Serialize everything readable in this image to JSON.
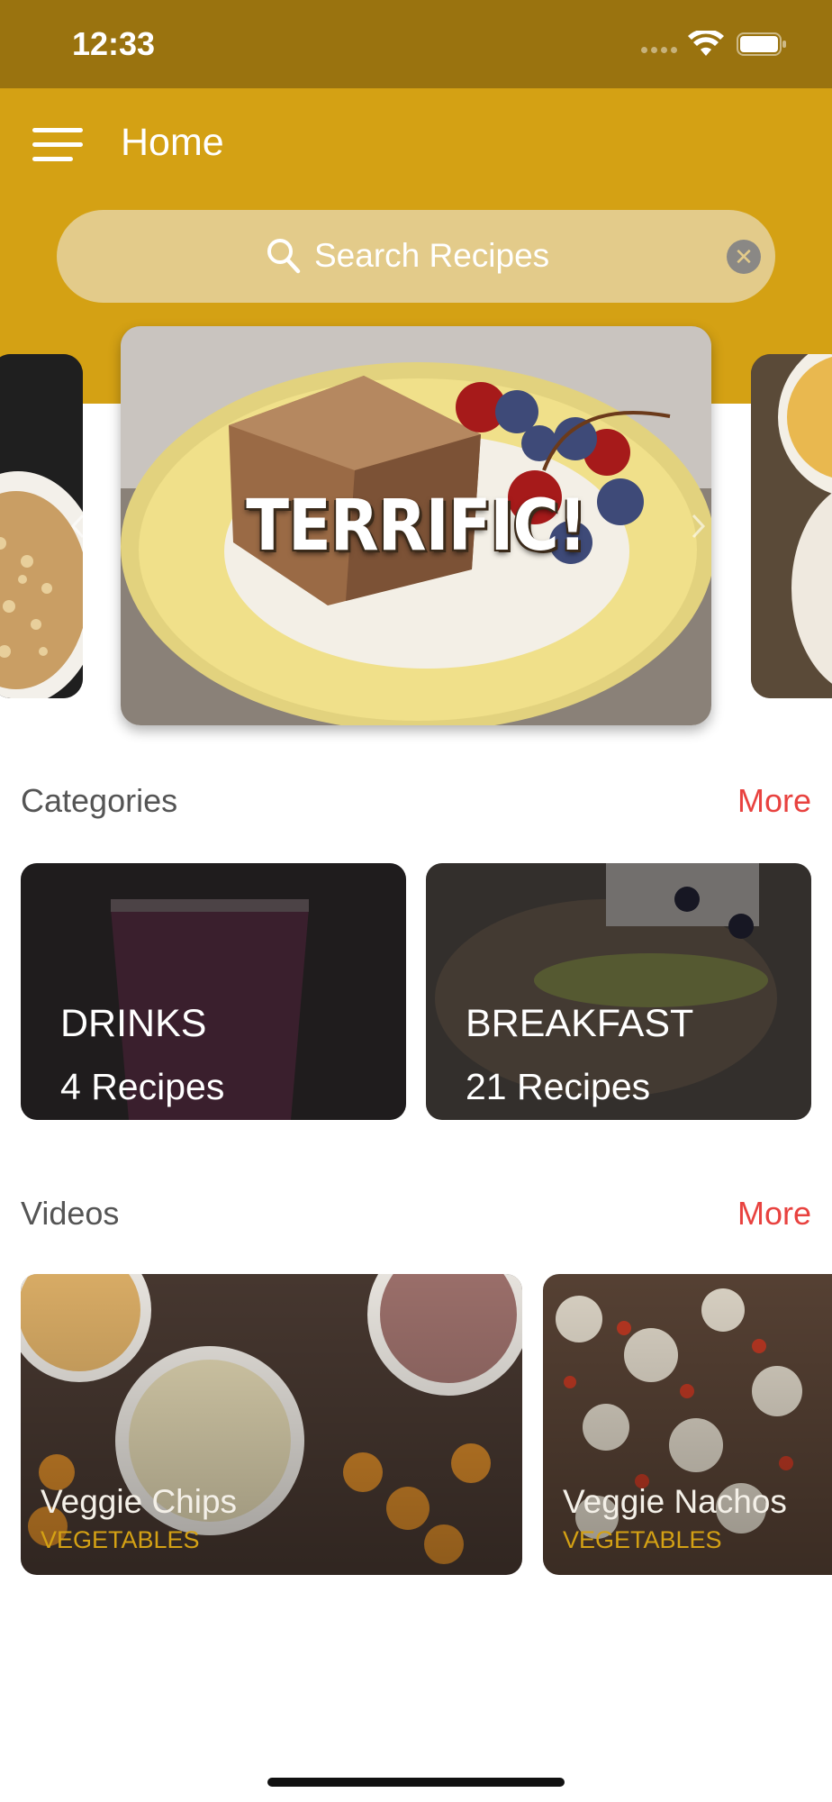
{
  "status_bar": {
    "time": "12:33"
  },
  "header": {
    "title": "Home",
    "search": {
      "placeholder": "Search Recipes"
    },
    "color": "#d4a114"
  },
  "carousel": {
    "featured_caption": "TERRIFIC!"
  },
  "categories": {
    "title": "Categories",
    "more_label": "More",
    "items": [
      {
        "name": "DRINKS",
        "count": "4 Recipes"
      },
      {
        "name": "BREAKFAST",
        "count": "21 Recipes"
      }
    ]
  },
  "videos": {
    "title": "Videos",
    "more_label": "More",
    "items": [
      {
        "title": "Veggie Chips",
        "category": "VEGETABLES"
      },
      {
        "title": "Veggie Nachos",
        "category": "VEGETABLES"
      }
    ]
  },
  "colors": {
    "accent": "#e8423f",
    "header": "#d4a114",
    "status_bar": "#9a730f"
  }
}
